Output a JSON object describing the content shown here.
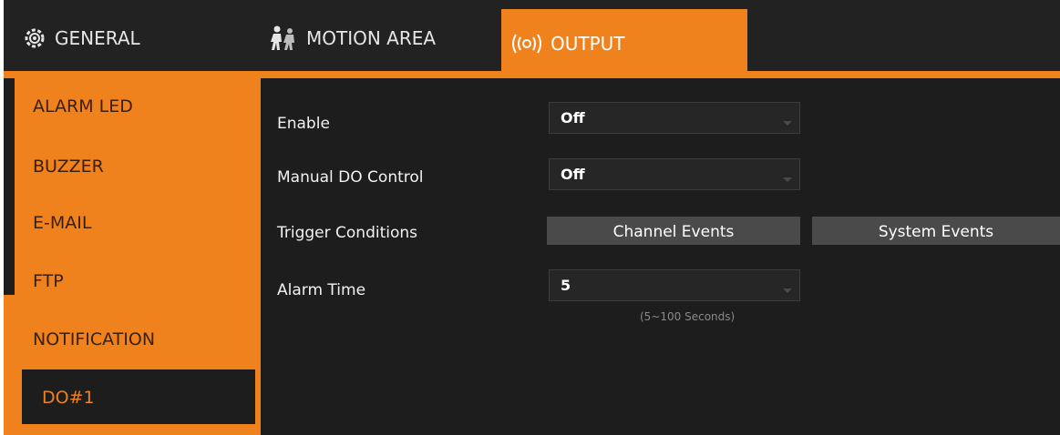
{
  "tabs": [
    {
      "label": "GENERAL",
      "icon": "gear-icon"
    },
    {
      "label": "MOTION AREA",
      "icon": "people-icon"
    },
    {
      "label": "OUTPUT",
      "icon": "signal-icon",
      "active": true
    }
  ],
  "sidebar": {
    "items": [
      "ALARM LED",
      "BUZZER",
      "E-MAIL",
      "FTP",
      "NOTIFICATION",
      "DO#1"
    ],
    "active": "DO#1"
  },
  "form": {
    "enable": {
      "label": "Enable",
      "value": "Off"
    },
    "manual_do": {
      "label": "Manual DO Control",
      "value": "Off"
    },
    "trigger": {
      "label": "Trigger Conditions",
      "channel_button": "Channel Events",
      "system_button": "System Events"
    },
    "alarm_time": {
      "label": "Alarm Time",
      "value": "5",
      "hint": "(5~100 Seconds)"
    }
  },
  "colors": {
    "accent": "#f0821e",
    "background": "#1d1d1d",
    "button": "#4a4a4a"
  }
}
